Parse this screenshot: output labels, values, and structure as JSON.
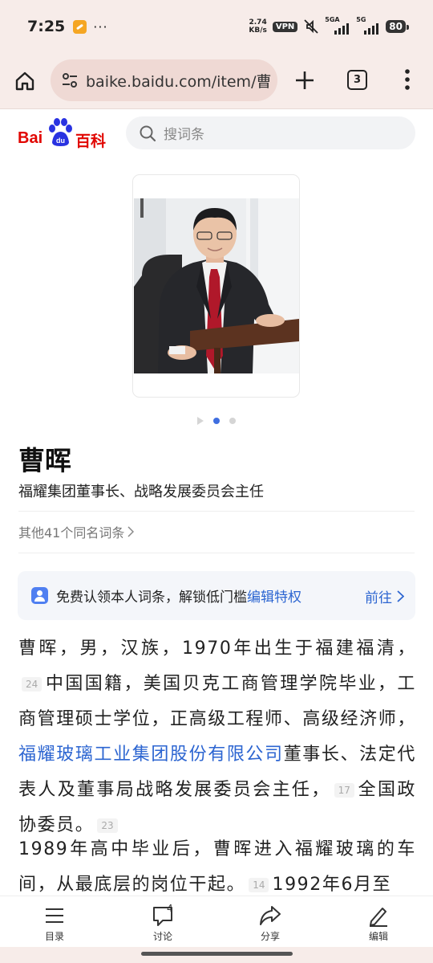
{
  "status_bar": {
    "time": "7:25",
    "more": "···",
    "speed_value": "2.74",
    "speed_unit": "KB/s",
    "vpn": "VPN",
    "net1": "5GA",
    "net2": "5G",
    "battery": "80"
  },
  "browser": {
    "url": "baike.baidu.com/item/曹",
    "tab_count": "3"
  },
  "header": {
    "logo_text_left": "Bai",
    "logo_text_paw": "du",
    "logo_text_right": "百科",
    "search_placeholder": "搜词条"
  },
  "entry": {
    "title": "曹晖",
    "subtitle": "福耀集团董事长、战略发展委员会主任",
    "others_link": "其他41个同名词条"
  },
  "claim_bar": {
    "text_prefix": "免费认领本人词条，解锁低门槛",
    "text_highlight": "编辑特权",
    "action": "前往"
  },
  "body": {
    "p1_a": "曹晖，男，汉族，1970年出生于福建福清，",
    "p1_ref1": "24",
    "p1_b": "中国国籍，美国贝克工商管理学院毕业，工商管理硕士学位，正高级工程师、高级经济师，",
    "p1_link": "福耀玻璃工业集团股份有限公司",
    "p1_c": "董事长、法定代表人及董事局战略发展委员会主任，",
    "p1_ref2": "17",
    "p1_d": "全国政协委员。",
    "p1_ref3": "23",
    "p2_a": "1989年高中毕业后，曹晖进入福耀玻璃的车间，从最底层的岗位干起。",
    "p2_ref1": "14",
    "p2_b": "1992年6月至"
  },
  "bottom_nav": {
    "toc": "目录",
    "discuss": "讨论",
    "discuss_count": "4",
    "share": "分享",
    "edit": "编辑"
  },
  "colors": {
    "brand_red": "#e10601",
    "link_blue": "#2c65d1",
    "chrome_bg": "#f7ece9"
  }
}
